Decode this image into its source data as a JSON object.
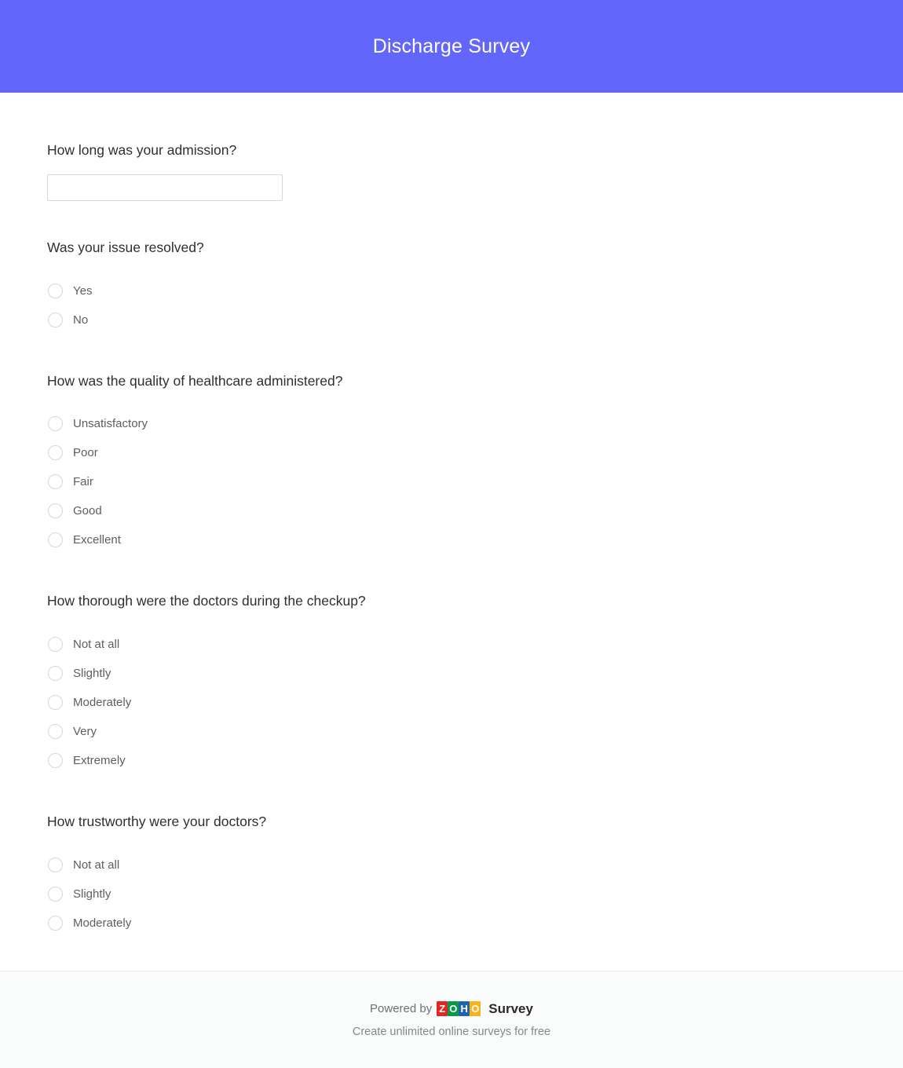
{
  "header": {
    "title": "Discharge Survey",
    "background_color": "#6366fb",
    "title_color": "#ffffff"
  },
  "survey": {
    "questions": [
      {
        "id": "q1",
        "title": "How long was your admission?",
        "type": "text",
        "value": "",
        "placeholder": ""
      },
      {
        "id": "q2",
        "title": "Was your issue resolved?",
        "type": "radio",
        "options": [
          {
            "label": "Yes",
            "selected": false
          },
          {
            "label": "No",
            "selected": false
          }
        ]
      },
      {
        "id": "q3",
        "title": "How was the quality of healthcare administered?",
        "type": "radio",
        "options": [
          {
            "label": "Unsatisfactory",
            "selected": false
          },
          {
            "label": "Poor",
            "selected": false
          },
          {
            "label": "Fair",
            "selected": false
          },
          {
            "label": "Good",
            "selected": false
          },
          {
            "label": "Excellent",
            "selected": false
          }
        ]
      },
      {
        "id": "q4",
        "title": "How thorough were the doctors during the checkup?",
        "type": "radio",
        "options": [
          {
            "label": "Not at all",
            "selected": false
          },
          {
            "label": "Slightly",
            "selected": false
          },
          {
            "label": "Moderately",
            "selected": false
          },
          {
            "label": "Very",
            "selected": false
          },
          {
            "label": "Extremely",
            "selected": false
          }
        ]
      },
      {
        "id": "q5",
        "title": "How trustworthy were your doctors?",
        "type": "radio",
        "options": [
          {
            "label": "Not at all",
            "selected": false
          },
          {
            "label": "Slightly",
            "selected": false
          },
          {
            "label": "Moderately",
            "selected": false
          }
        ]
      }
    ]
  },
  "footer": {
    "powered_by_text": "Powered by",
    "brand_letters": [
      "Z",
      "O",
      "H",
      "O"
    ],
    "brand_colors": [
      "#e42527",
      "#089949",
      "#2064ad",
      "#f9b21d"
    ],
    "brand_product": "Survey",
    "tagline": "Create unlimited online surveys for free"
  }
}
